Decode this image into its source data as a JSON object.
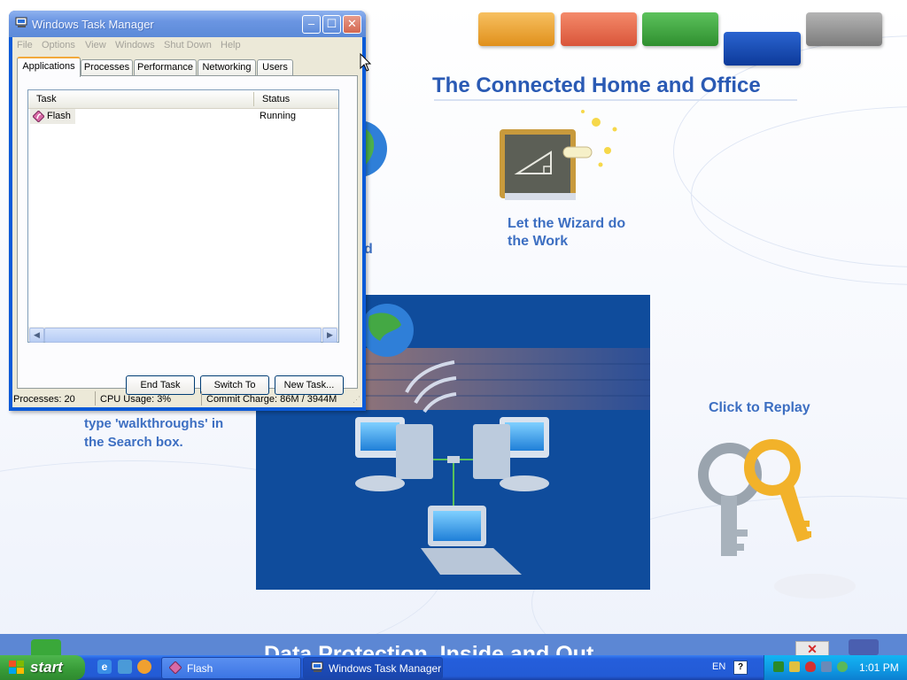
{
  "presentation": {
    "heading": "The Connected Home and Office",
    "wizard_text": "Let the Wizard do the Work",
    "replay_text": "Click to Replay",
    "walkthrough_text": "type 'walkthroughs' in the Search box.",
    "partial_text": "d",
    "bottom_banner": "Data Protection, Inside and Out",
    "top_buttons": [
      {
        "color": "#f0a030"
      },
      {
        "color": "#ec6a4a"
      },
      {
        "color": "#3aa83a"
      },
      {
        "color": "#1446b0"
      },
      {
        "color": "#8c8c8c"
      }
    ]
  },
  "task_manager": {
    "title": "Windows Task Manager",
    "menu": [
      "File",
      "Options",
      "View",
      "Windows",
      "Shut Down",
      "Help"
    ],
    "tabs": [
      "Applications",
      "Processes",
      "Performance",
      "Networking",
      "Users"
    ],
    "active_tab": "Applications",
    "columns": [
      "Task",
      "Status"
    ],
    "rows": [
      {
        "task": "Flash",
        "status": "Running"
      }
    ],
    "buttons": {
      "end_task": "End Task",
      "switch_to": "Switch To",
      "new_task": "New Task..."
    },
    "status": {
      "processes": "Processes: 20",
      "cpu": "CPU Usage: 3%",
      "commit": "Commit Charge: 86M / 3944M"
    }
  },
  "taskbar": {
    "start_label": "start",
    "tasks": [
      {
        "label": "Flash",
        "icon": "flash-icon"
      },
      {
        "label": "Windows Task Manager",
        "icon": "task-manager-icon"
      }
    ],
    "language": "EN",
    "help_label": "?",
    "clock": "1:01 PM",
    "tray_icons": [
      "network-icon",
      "sound-icon",
      "security-shield-icon",
      "display-icon",
      "sync-icon"
    ]
  },
  "colors": {
    "heading_blue": "#2a5ab4",
    "text_blue": "#3d6fc2",
    "xp_title_blue": "#0a5ad8",
    "start_green": "#379a37"
  }
}
